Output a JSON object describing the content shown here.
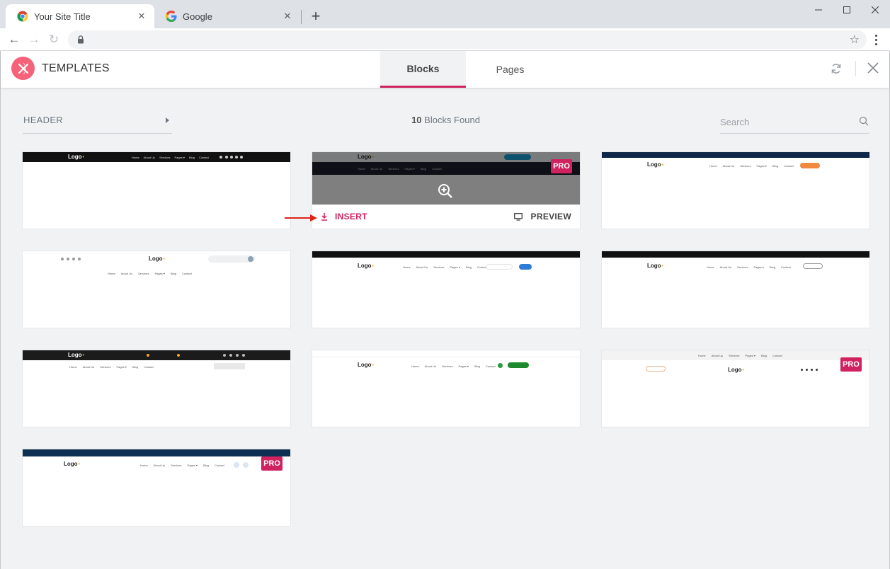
{
  "browser": {
    "tabs": [
      {
        "title": "Your Site Title",
        "close": "✕"
      },
      {
        "title": "Google",
        "close": "✕"
      }
    ],
    "new_tab": "+",
    "window_controls": {
      "minimize": "—",
      "maximize": "☐",
      "close": "✕"
    },
    "nav": {
      "back": "←",
      "forward": "→",
      "reload": "↻"
    },
    "address": "",
    "bookmark_star": "☆"
  },
  "library": {
    "title": "TEMPLATES",
    "tabs": [
      {
        "label": "Blocks",
        "active": true
      },
      {
        "label": "Pages",
        "active": false
      }
    ],
    "filter_label": "HEADER",
    "found_count": "10",
    "found_suffix": " Blocks Found",
    "search_placeholder": "Search",
    "accent_color": "#d0225f",
    "card_actions": {
      "insert": "INSERT",
      "preview": "PREVIEW"
    },
    "pro_badge": "PRO",
    "card_logo": "Logo",
    "card_nav": [
      "Home",
      "About Us",
      "Services",
      "Pages ▾",
      "Blog",
      "Contact"
    ],
    "cards": [
      {
        "id": 1,
        "pro": false,
        "hover": false
      },
      {
        "id": 2,
        "pro": true,
        "hover": true
      },
      {
        "id": 3,
        "pro": false,
        "hover": false
      },
      {
        "id": 4,
        "pro": false,
        "hover": false
      },
      {
        "id": 5,
        "pro": false,
        "hover": false
      },
      {
        "id": 6,
        "pro": false,
        "hover": false
      },
      {
        "id": 7,
        "pro": false,
        "hover": false
      },
      {
        "id": 8,
        "pro": false,
        "hover": false
      },
      {
        "id": 9,
        "pro": true,
        "hover": false
      },
      {
        "id": 10,
        "pro": true,
        "hover": false
      }
    ]
  }
}
